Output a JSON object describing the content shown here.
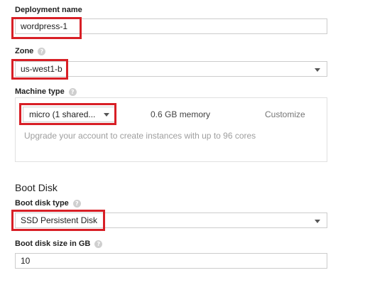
{
  "deployment": {
    "label": "Deployment name",
    "value": "wordpress-1"
  },
  "zone": {
    "label": "Zone",
    "help_icon": "help-icon",
    "value": "us-west1-b"
  },
  "machine": {
    "label": "Machine type",
    "help_icon": "help-icon",
    "type_value": "micro (1 shared...",
    "memory": "0.6 GB memory",
    "customize": "Customize",
    "upgrade_note": "Upgrade your account to create instances with up to 96 cores"
  },
  "boot_disk": {
    "section_title": "Boot Disk",
    "type_label": "Boot disk type",
    "type_value": "SSD Persistent Disk",
    "size_label": "Boot disk size in GB",
    "size_value": "10",
    "help_icon": "help-icon"
  },
  "colors": {
    "highlight": "#d81f26",
    "border": "#cccccc",
    "muted_text": "#9e9e9e"
  }
}
